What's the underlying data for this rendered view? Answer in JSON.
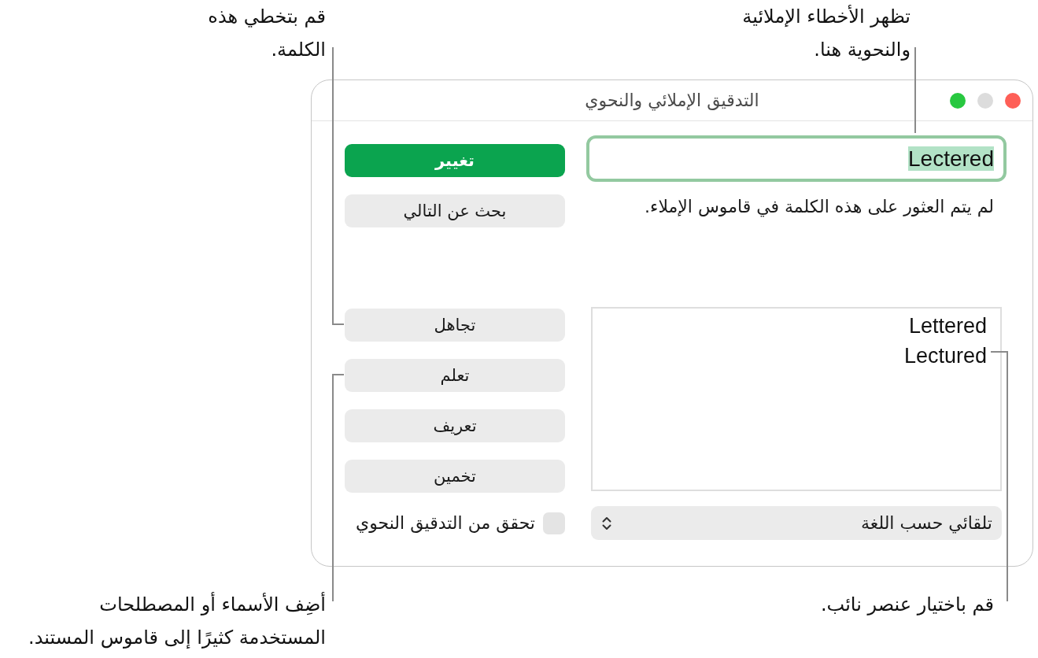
{
  "window": {
    "title": "التدقيق الإملائي والنحوي",
    "controls": [
      {
        "kind": "close",
        "disabled": false
      },
      {
        "kind": "minimize",
        "disabled": true
      },
      {
        "kind": "zoom",
        "disabled": false
      }
    ]
  },
  "spelling_field": {
    "value": "Lectered",
    "focused": true,
    "text_selected": true
  },
  "message": "لم يتم العثور على هذه الكلمة في قاموس الإملاء.",
  "suggestions": [
    {
      "text": "Lettered",
      "selected": false
    },
    {
      "text": "Lectured",
      "selected": false
    }
  ],
  "language_popup": {
    "value": "تلقائي حسب اللغة"
  },
  "action_buttons": [
    {
      "label": "تغيير",
      "default": true
    },
    {
      "label": "بحث عن التالي",
      "default": false
    }
  ],
  "word_buttons": [
    {
      "label": "تجاهل",
      "default": false
    },
    {
      "label": "تعلم",
      "default": false
    },
    {
      "label": "تعريف",
      "default": false
    },
    {
      "label": "تخمين",
      "default": false
    }
  ],
  "grammar_check": {
    "label": "تحقق من التدقيق النحوي",
    "checked": false
  },
  "callouts": [
    {
      "lines": [
        "تظهر الأخطاء الإملائية",
        "والنحوية هنا."
      ]
    },
    {
      "lines": [
        "قم بتخطي هذه",
        "الكلمة."
      ]
    },
    {
      "lines": [
        "قم باختيار عنصر نائب."
      ]
    },
    {
      "lines": [
        "أضِف الأسماء أو المصطلحات",
        "المستخدمة كثيرًا إلى قاموس المستند."
      ]
    }
  ]
}
